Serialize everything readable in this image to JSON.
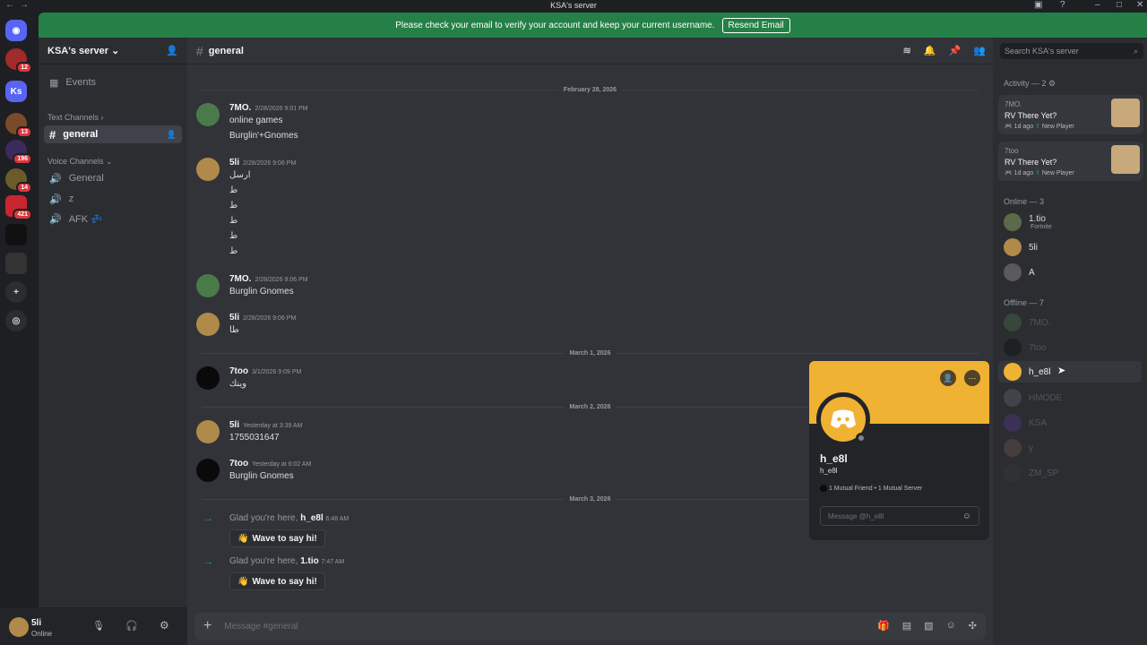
{
  "window": {
    "title": "KSA's server"
  },
  "banner": {
    "text": "Please check your email to verify your account and keep your current username.",
    "button": "Resend Email"
  },
  "guilds": [
    {
      "badge": "12",
      "color": "#a12b2b"
    },
    {
      "label": "Ks",
      "color": "#5865f2"
    },
    {
      "badge": "13",
      "color": "#7a4b2a"
    },
    {
      "badge": "196",
      "color": "#3a2a5e"
    },
    {
      "badge": "14",
      "color": "#6b5a2a"
    },
    {
      "badge": "421",
      "color": "#c8262f"
    },
    {
      "badge": "",
      "color": "#111111"
    },
    {
      "badge": "",
      "color": "#333333"
    }
  ],
  "sidebar": {
    "server_name": "KSA's server",
    "events": "Events",
    "text_category": "Text Channels",
    "text_channels": [
      {
        "name": "general"
      }
    ],
    "voice_category": "Voice Channels",
    "voice_channels": [
      {
        "name": "General"
      },
      {
        "name": "z"
      },
      {
        "name": "AFK 💤"
      }
    ]
  },
  "user": {
    "name": "5li",
    "status": "Online"
  },
  "channel": {
    "name": "general"
  },
  "dividers": [
    "February 28, 2026",
    "March 1, 2026",
    "March 2, 2026",
    "March 3, 2026"
  ],
  "messages": [
    {
      "author": "7MO.",
      "time": "2/28/2026 9:01 PM",
      "lines": [
        "online games",
        "Burglin'+Gnomes"
      ]
    },
    {
      "author": "5li",
      "time": "2/28/2026 9:06 PM",
      "lines": [
        "ارسل",
        "ط",
        "ط",
        "ط",
        "ط",
        "ط"
      ]
    },
    {
      "author": "7MO.",
      "time": "2/28/2026 9:06 PM",
      "lines": [
        "Burglin Gnomes"
      ]
    },
    {
      "author": "5li",
      "time": "2/28/2026 9:06 PM",
      "lines": [
        "طا"
      ]
    },
    {
      "author": "7too",
      "time": "3/1/2026 9:09 PM",
      "lines": [
        "وينك"
      ]
    },
    {
      "author": "5li",
      "time": "Yesterday at 3:39 AM",
      "lines": [
        "1755031647"
      ]
    },
    {
      "author": "7too",
      "time": "Yesterday at 6:02 AM",
      "lines": [
        "Burglin Gnomes"
      ]
    }
  ],
  "system_messages": [
    {
      "prefix": "Glad you're here,",
      "user": "h_e8l",
      "time": "6:48 AM",
      "button": "Wave to say hi!"
    },
    {
      "prefix": "Glad you're here,",
      "user": "1.tio",
      "time": "7:47 AM",
      "button": "Wave to say hi!"
    }
  ],
  "composer": {
    "placeholder": "Message #general"
  },
  "members": {
    "search_placeholder": "Search KSA's server",
    "activity_title": "Activity — 2",
    "activities": [
      {
        "user": "7MO.",
        "game": "RV There Yet?",
        "ago": "1d ago",
        "tag": "New Player"
      },
      {
        "user": "7too",
        "game": "RV There Yet?",
        "ago": "1d ago",
        "tag": "New Player"
      }
    ],
    "online_title": "Online — 3",
    "online": [
      {
        "name": "1.tio",
        "sub": "Fortnite"
      },
      {
        "name": "5li",
        "sub": ""
      },
      {
        "name": "A",
        "sub": ""
      }
    ],
    "offline_title": "Offline — 7",
    "offline": [
      {
        "name": "7MO."
      },
      {
        "name": "7too"
      },
      {
        "name": "h_e8l"
      },
      {
        "name": "HMODE"
      },
      {
        "name": "KSA"
      },
      {
        "name": "y"
      },
      {
        "name": "ZM_SP"
      }
    ]
  },
  "profile_popup": {
    "display_name": "h_e8l",
    "username": "h_e8l",
    "mutual": "1 Mutual Friend • 1 Mutual Server",
    "message_placeholder": "Message @h_e8l",
    "accent": "#f0b232"
  }
}
